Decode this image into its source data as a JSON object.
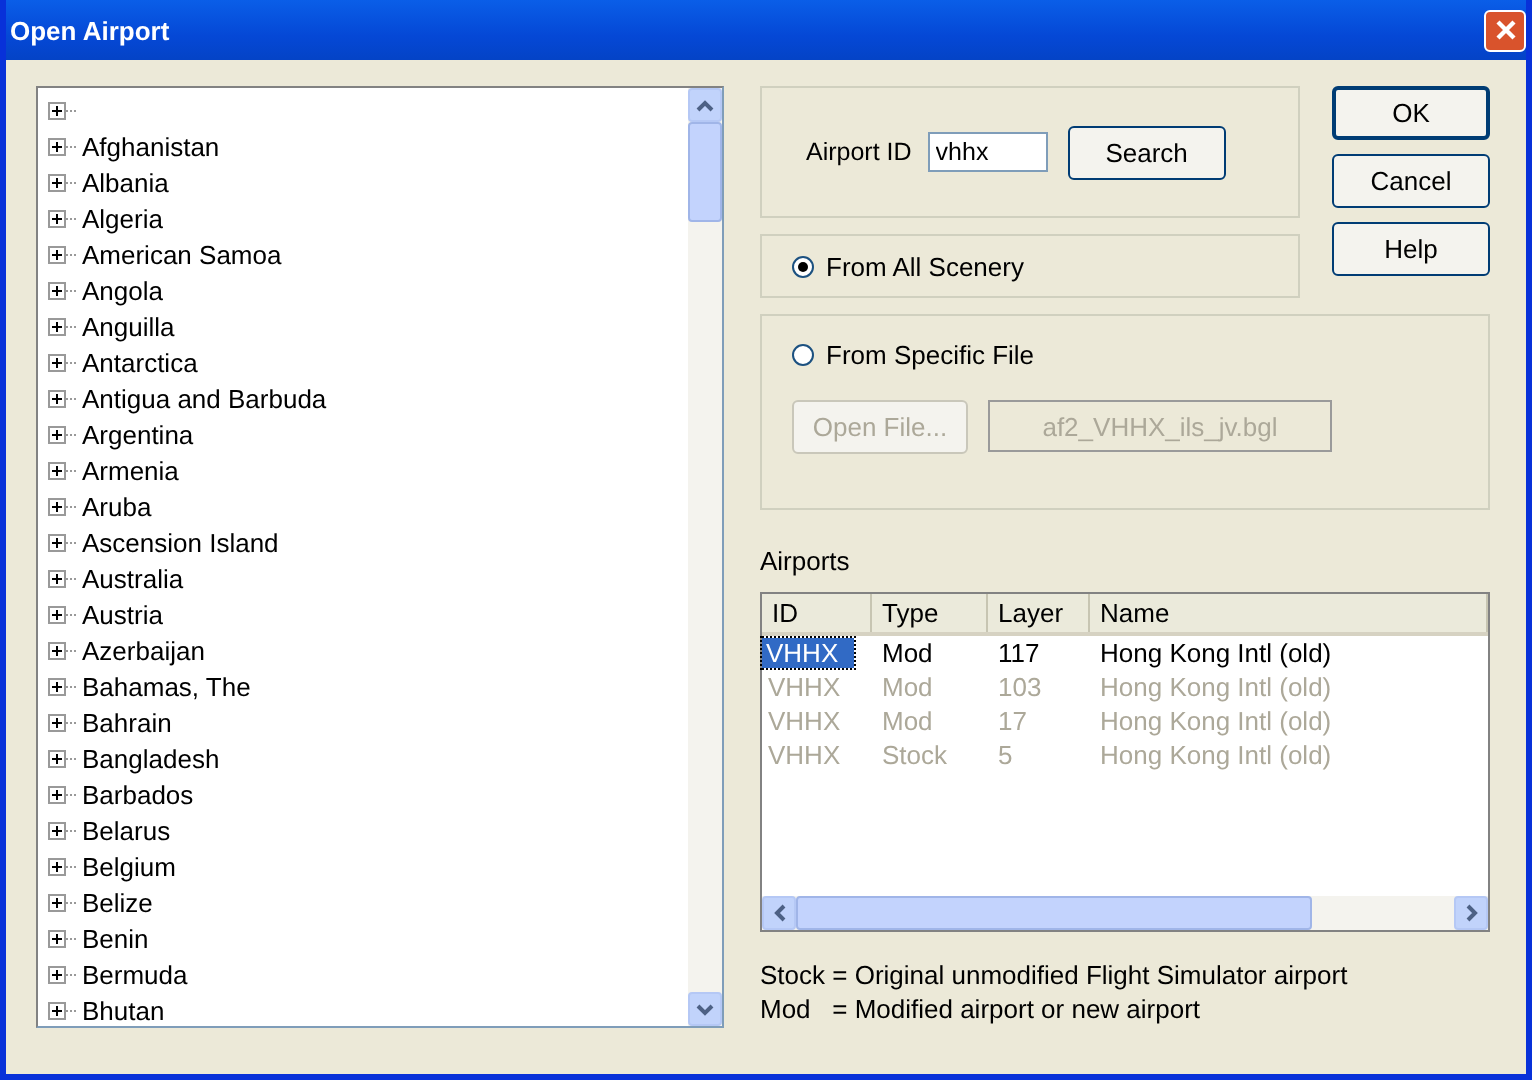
{
  "window": {
    "title": "Open Airport"
  },
  "tree": {
    "items": [
      {
        "expanded": false
      },
      {
        "label": "Afghanistan",
        "expanded": false
      },
      {
        "label": "Albania",
        "expanded": false
      },
      {
        "label": "Algeria",
        "expanded": false
      },
      {
        "label": "American Samoa",
        "expanded": false
      },
      {
        "label": "Angola",
        "expanded": false
      },
      {
        "label": "Anguilla",
        "expanded": false
      },
      {
        "label": "Antarctica",
        "expanded": false
      },
      {
        "label": "Antigua and Barbuda",
        "expanded": false
      },
      {
        "label": "Argentina",
        "expanded": false
      },
      {
        "label": "Armenia",
        "expanded": false
      },
      {
        "label": "Aruba",
        "expanded": false
      },
      {
        "label": "Ascension Island",
        "expanded": false
      },
      {
        "label": "Australia",
        "expanded": false
      },
      {
        "label": "Austria",
        "expanded": false
      },
      {
        "label": "Azerbaijan",
        "expanded": false
      },
      {
        "label": "Bahamas, The",
        "expanded": false
      },
      {
        "label": "Bahrain",
        "expanded": false
      },
      {
        "label": "Bangladesh",
        "expanded": false
      },
      {
        "label": "Barbados",
        "expanded": false
      },
      {
        "label": "Belarus",
        "expanded": false
      },
      {
        "label": "Belgium",
        "expanded": false
      },
      {
        "label": "Belize",
        "expanded": false
      },
      {
        "label": "Benin",
        "expanded": false
      },
      {
        "label": "Bermuda",
        "expanded": false
      },
      {
        "label": "Bhutan",
        "expanded": false
      }
    ]
  },
  "search": {
    "label": "Airport ID",
    "value": "vhhx",
    "button": "Search"
  },
  "sources": [
    {
      "label": "From All Scenery",
      "selected": true
    },
    {
      "label": "From Specific File",
      "selected": false
    }
  ],
  "file": {
    "button": "Open File...",
    "value": "af2_VHHX_ils_jv.bgl",
    "disabled": true
  },
  "buttons": [
    "OK",
    "Cancel",
    "Help"
  ],
  "airports": {
    "label": "Airports",
    "columns": [
      "ID",
      "Type",
      "Layer",
      "Name"
    ],
    "rows": [
      {
        "cells": [
          "VHHX",
          "Mod",
          "117",
          "Hong Kong Intl (old)"
        ],
        "selected": true,
        "disabled": false
      },
      {
        "cells": [
          "VHHX",
          "Mod",
          "103",
          "Hong Kong Intl (old)"
        ],
        "selected": false,
        "disabled": true
      },
      {
        "cells": [
          "VHHX",
          "Mod",
          "17",
          "Hong Kong Intl (old)"
        ],
        "selected": false,
        "disabled": true
      },
      {
        "cells": [
          "VHHX",
          "Stock",
          "5",
          "Hong Kong Intl (old)"
        ],
        "selected": false,
        "disabled": true
      }
    ]
  },
  "legend": [
    "Stock = Original unmodified Flight Simulator airport",
    "Mod   = Modified airport or new airport"
  ]
}
